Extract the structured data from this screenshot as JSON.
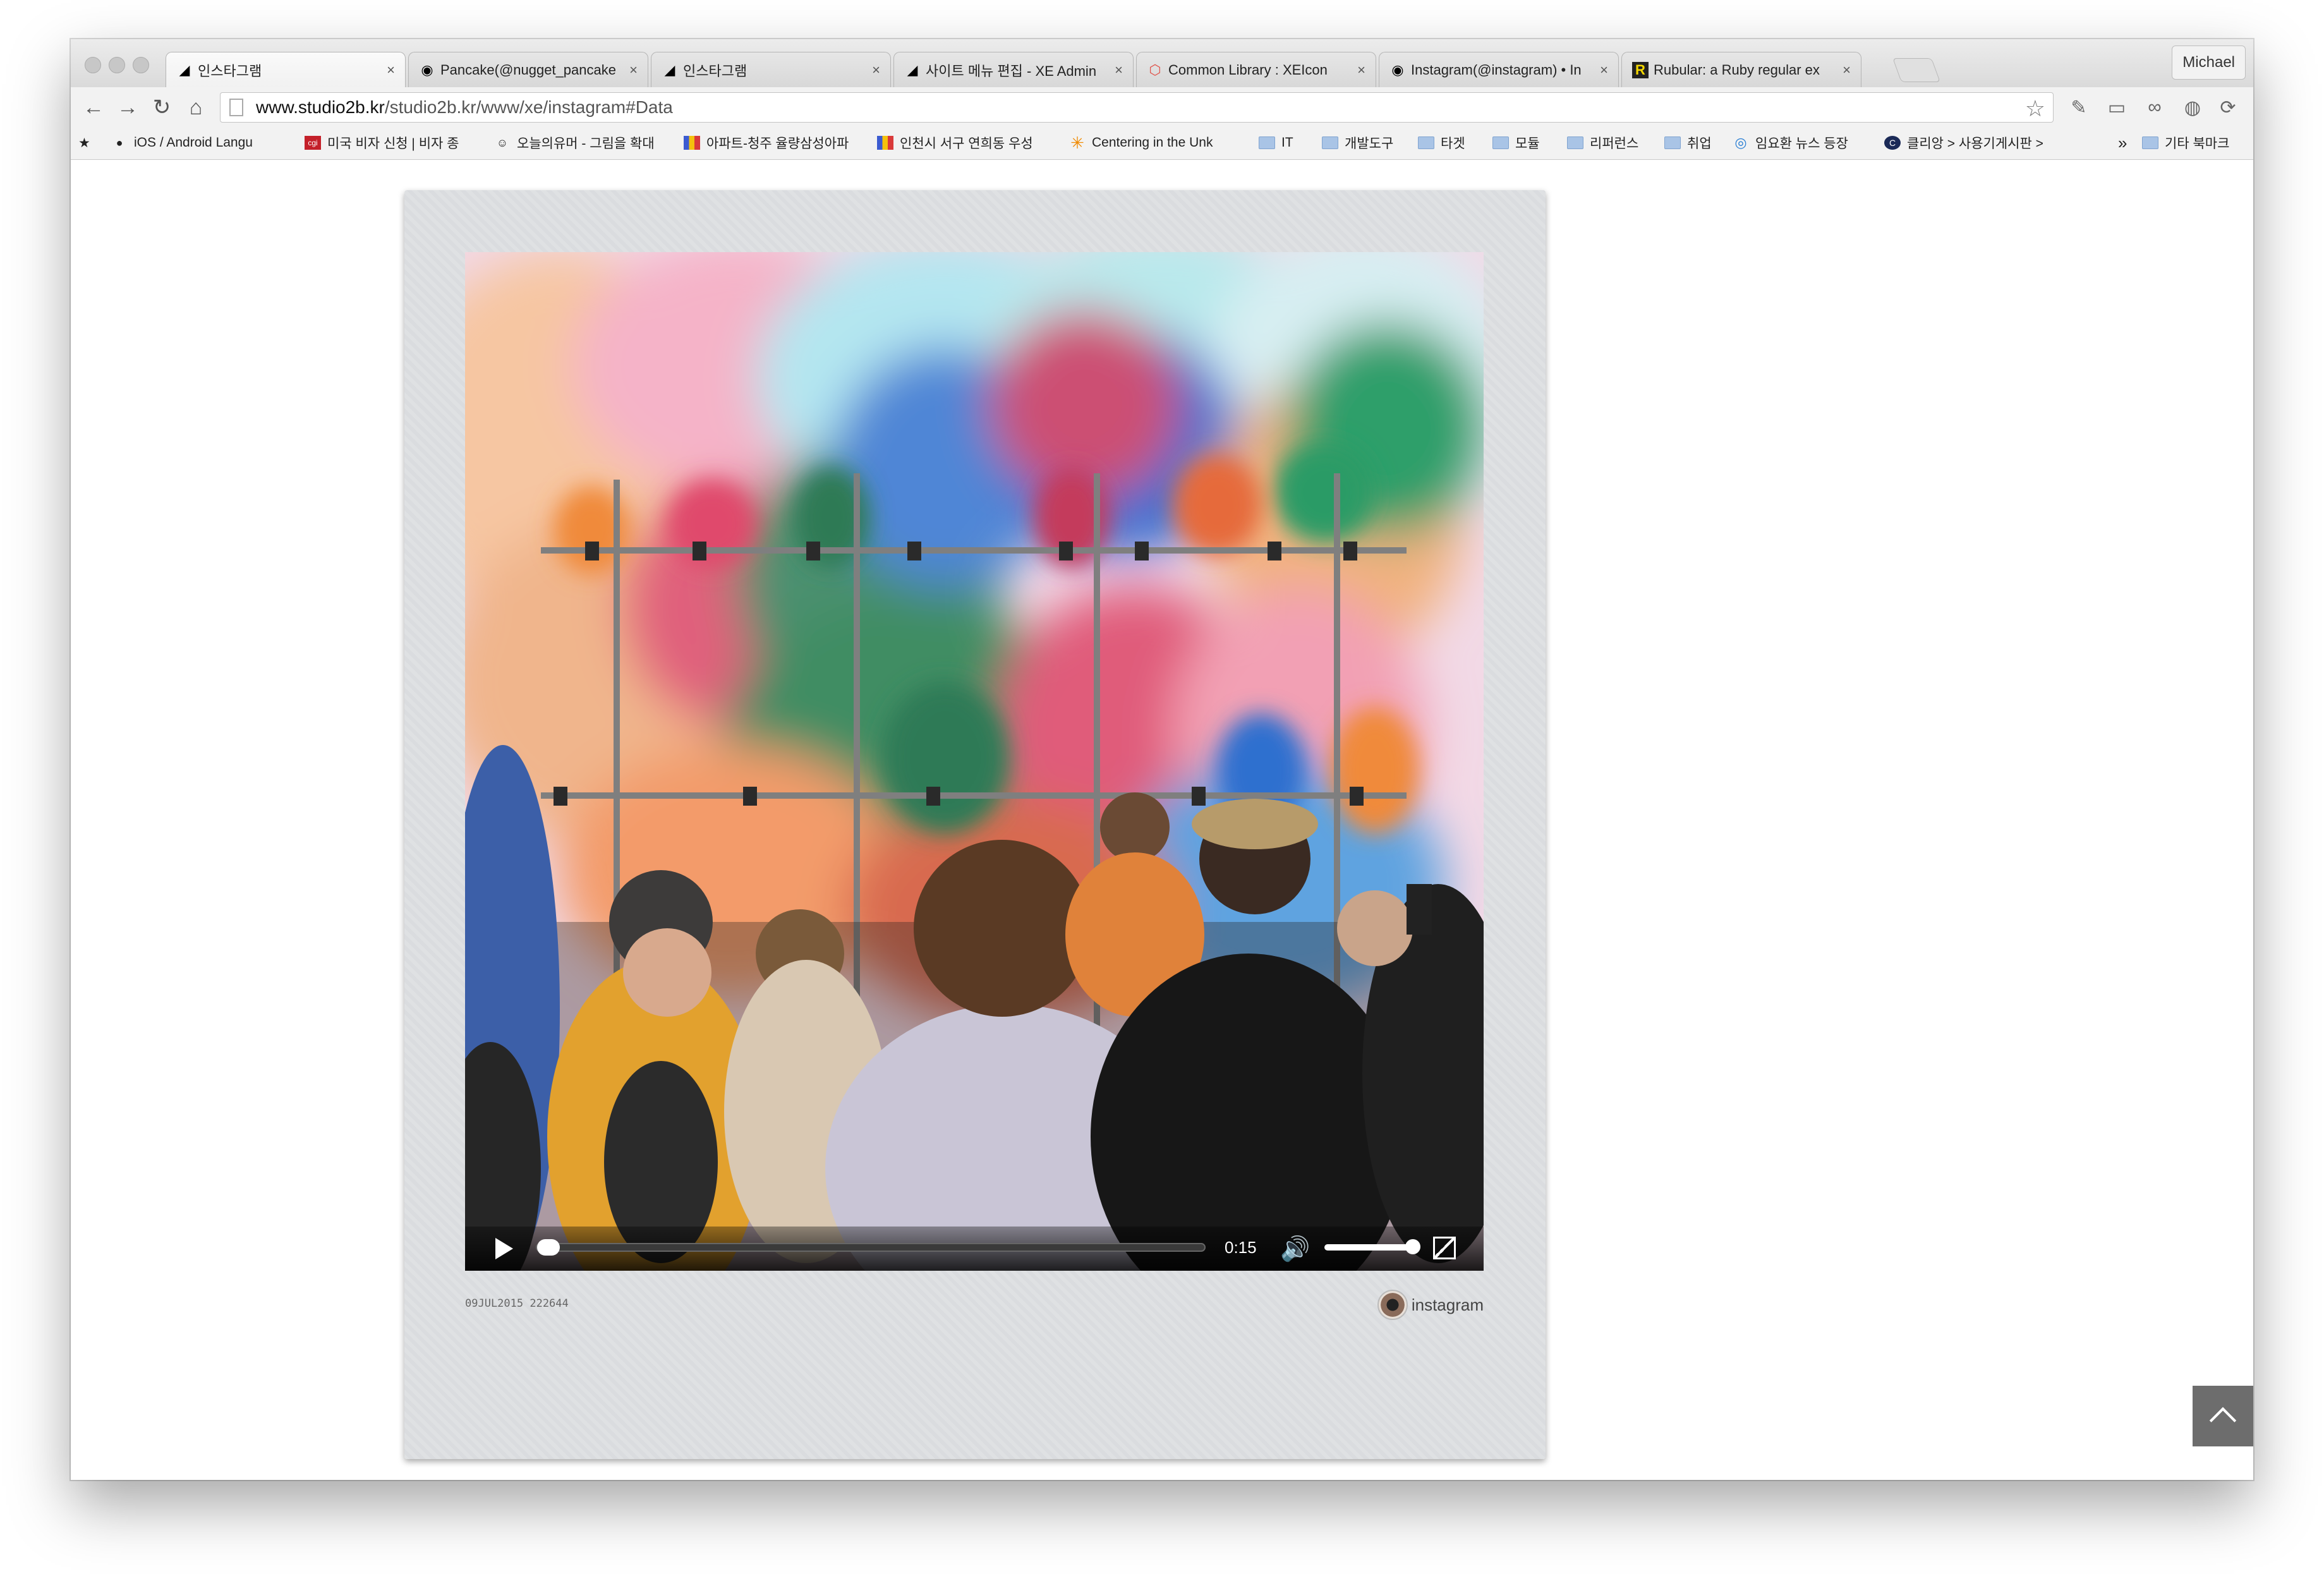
{
  "browser": {
    "profile_name": "Michael",
    "tabs": [
      {
        "title": "인스타그램",
        "icon": "xe-icon",
        "active": true
      },
      {
        "title": "Pancake(@nugget_pancake",
        "icon": "instagram-icon"
      },
      {
        "title": "인스타그램",
        "icon": "xe-icon"
      },
      {
        "title": "사이트 메뉴 편집 - XE Admin",
        "icon": "xe-icon"
      },
      {
        "title": "Common Library : XEIcon",
        "icon": "xeicon-icon"
      },
      {
        "title": "Instagram(@instagram) • In",
        "icon": "instagram-icon"
      },
      {
        "title": "Rubular: a Ruby regular ex",
        "icon": "rubular-icon"
      }
    ],
    "close_glyph": "×",
    "url_host": "www.studio2b.kr",
    "url_path": "/studio2b.kr/www/xe/instagram#Data",
    "bookmarks": [
      {
        "label": "iOS / Android Langu",
        "icon": "avatar-icon"
      },
      {
        "label": "미국 비자 신청 | 비자 종",
        "icon": "cgi-icon"
      },
      {
        "label": "오늘의유머 - 그림을 확대",
        "icon": "todayhumor-icon"
      },
      {
        "label": "아파트-청주 율량삼성아파",
        "icon": "flag-icon"
      },
      {
        "label": "인천시 서구 연희동 우성",
        "icon": "flag-icon"
      },
      {
        "label": "Centering in the Unk",
        "icon": "asterisk-icon"
      },
      {
        "label": "IT",
        "icon": "folder-icon"
      },
      {
        "label": "개발도구",
        "icon": "folder-icon"
      },
      {
        "label": "타겟",
        "icon": "folder-icon"
      },
      {
        "label": "모듈",
        "icon": "folder-icon"
      },
      {
        "label": "리퍼런스",
        "icon": "folder-icon"
      },
      {
        "label": "취업",
        "icon": "folder-icon"
      },
      {
        "label": "임요환 뉴스 등장",
        "icon": "ring-icon"
      },
      {
        "label": "클리앙 > 사용기게시판 >",
        "icon": "clien-icon"
      }
    ],
    "bookmarks_overflow": "»",
    "other_bookmarks": "기타 북마크"
  },
  "post": {
    "video_time": "0:15",
    "progress": 0.0,
    "volume": 1.0,
    "date_text": "09JUL2015 222644",
    "account": "instagram"
  },
  "colors": {
    "card_bg": "#dcdee1",
    "totop_bg": "#6d6d6d"
  }
}
